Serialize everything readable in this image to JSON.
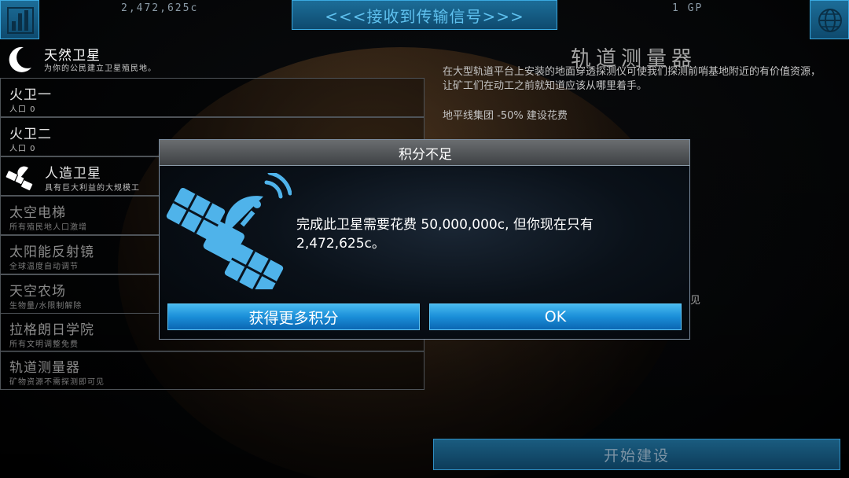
{
  "top_bar": {
    "credits": "2,472,625c",
    "signal_banner": "<<<接收到传输信号>>>",
    "gp": "1 GP"
  },
  "category": {
    "title": "天然卫星",
    "subtitle": "为你的公民建立卫星殖民地。"
  },
  "list": [
    {
      "name": "火卫一",
      "desc": "人口 0"
    },
    {
      "name": "火卫二",
      "desc": "人口 0"
    },
    {
      "name": "人造卫星",
      "desc": "具有巨大利益的大规模工"
    },
    {
      "name": "太空电梯",
      "desc": "所有殖民地人口激增"
    },
    {
      "name": "太阳能反射镜",
      "desc": "全球温度自动调节"
    },
    {
      "name": "天空农场",
      "desc": "生物量/水限制解除"
    },
    {
      "name": "拉格朗日学院",
      "desc": "所有文明调整免费"
    },
    {
      "name": "轨道测量器",
      "desc": "矿物资源不需探测即可见"
    }
  ],
  "info": {
    "title": "轨道测量器",
    "description": "在大型轨道平台上安装的地面穿透探测仪可使我们探测前哨基地附近的有价值资源，让矿工们在动工之前就知道应该从哪里着手。",
    "bonus": "地平线集团 -50% 建设花费",
    "fragment": "见"
  },
  "start_build_label": "开始建设",
  "modal": {
    "title": "积分不足",
    "message": "完成此卫星需要花费 50,000,000c, 但你现在只有 2,472,625c。",
    "get_credits_label": "获得更多积分",
    "ok_label": "OK"
  },
  "colors": {
    "accent": "#1a8ed8",
    "banner_text": "#5ec0ee",
    "icon_blue": "#4fb3ea"
  }
}
